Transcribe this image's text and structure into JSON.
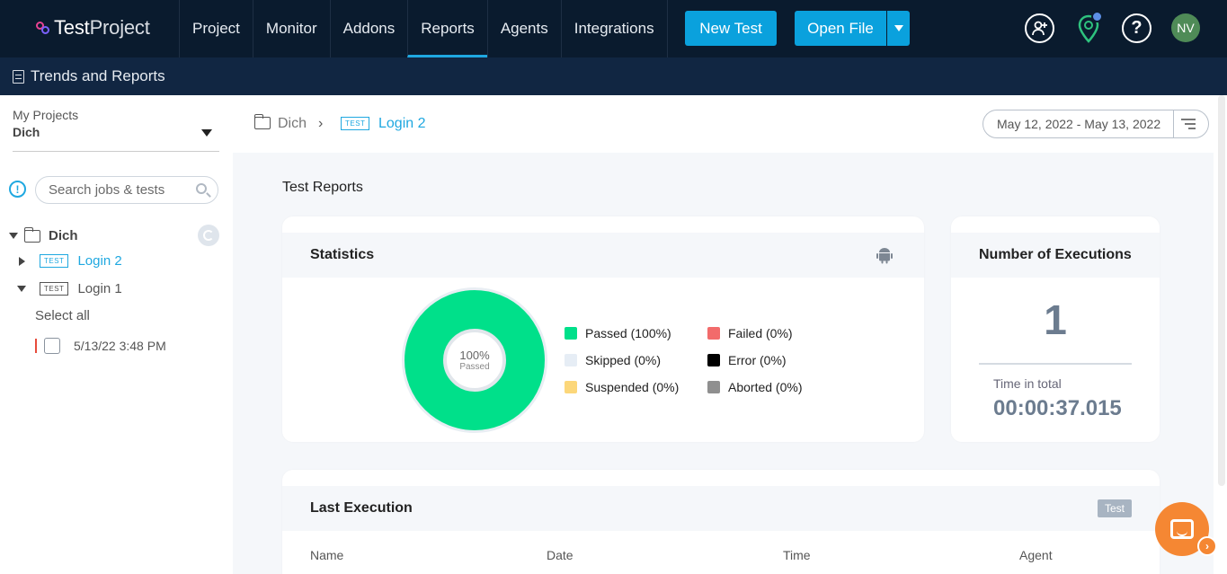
{
  "app": {
    "logo_test": "Test",
    "logo_project": "Project",
    "nav": [
      "Project",
      "Monitor",
      "Addons",
      "Reports",
      "Agents",
      "Integrations"
    ],
    "active_nav": "Reports",
    "new_test": "New Test",
    "open_file": "Open File",
    "help_glyph": "?",
    "avatar_initials": "NV",
    "colors": {
      "topbar": "#0a1b2e",
      "subbar": "#112642",
      "accent": "#0aa1dd",
      "passed": "#00e08a"
    }
  },
  "subbar": {
    "title": "Trends and Reports"
  },
  "sidebar": {
    "my_projects_label": "My Projects",
    "project": "Dich",
    "search_placeholder": "Search jobs & tests",
    "info_glyph": "!",
    "tree": {
      "folder": "Dich",
      "tests": [
        {
          "tag": "TEST",
          "name": "Login 2",
          "selected": true
        },
        {
          "tag": "TEST",
          "name": "Login 1",
          "selected": false
        }
      ],
      "select_all": "Select all",
      "run_time": "5/13/22 3:48 PM"
    }
  },
  "breadcrumb": {
    "folder": "Dich",
    "separator": "›",
    "tag": "TEST",
    "test": "Login 2"
  },
  "date_range": "May 12, 2022 - May 13, 2022",
  "reports": {
    "section_title": "Test Reports",
    "statistics": {
      "title": "Statistics",
      "center_pct": "100%",
      "center_label": "Passed",
      "legend": [
        {
          "label": "Passed (100%)",
          "color": "#00e08a"
        },
        {
          "label": "Failed (0%)",
          "color": "#f26b6b"
        },
        {
          "label": "Skipped (0%)",
          "color": "#e6edf5"
        },
        {
          "label": "Error (0%)",
          "color": "#000000"
        },
        {
          "label": "Suspended (0%)",
          "color": "#fcd77a"
        },
        {
          "label": "Aborted (0%)",
          "color": "#8f8f8f"
        }
      ]
    },
    "executions": {
      "title": "Number of Executions",
      "count": "1",
      "time_label": "Time in total",
      "time_value": "00:00:37.015"
    },
    "last_execution": {
      "title": "Last Execution",
      "badge": "Test",
      "columns": [
        "Name",
        "Date",
        "Time",
        "Agent"
      ]
    }
  },
  "chat": {
    "arrow_glyph": "›"
  }
}
